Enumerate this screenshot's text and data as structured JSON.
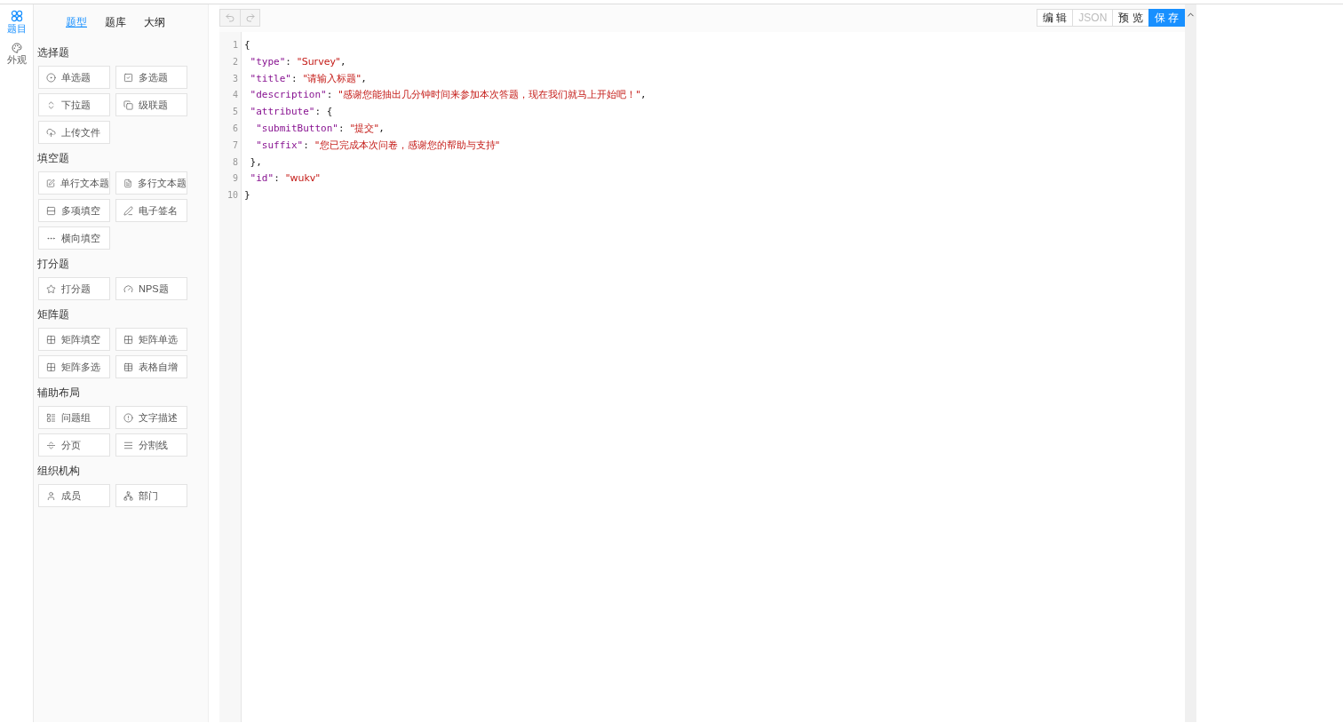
{
  "rail": [
    {
      "label": "题目",
      "selected": true
    },
    {
      "label": "外观",
      "selected": false
    }
  ],
  "tabs": [
    {
      "label": "题型",
      "selected": true
    },
    {
      "label": "题库",
      "selected": false
    },
    {
      "label": "大纲",
      "selected": false
    }
  ],
  "groups": [
    {
      "title": "选择题",
      "items": [
        "单选题",
        "多选题",
        "下拉题",
        "级联题",
        "上传文件"
      ]
    },
    {
      "title": "填空题",
      "items": [
        "单行文本题",
        "多行文本题",
        "多项填空",
        "电子签名",
        "横向填空"
      ]
    },
    {
      "title": "打分题",
      "items": [
        "打分题",
        "NPS题"
      ]
    },
    {
      "title": "矩阵题",
      "items": [
        "矩阵填空",
        "矩阵单选",
        "矩阵多选",
        "表格自增"
      ]
    },
    {
      "title": "辅助布局",
      "items": [
        "问题组",
        "文字描述",
        "分页",
        "分割线"
      ]
    },
    {
      "title": "组织机构",
      "items": [
        "成员",
        "部门"
      ]
    }
  ],
  "actions": [
    {
      "label": "编 辑",
      "kind": "default"
    },
    {
      "label": "JSON",
      "kind": "disabled"
    },
    {
      "label": "预 览",
      "kind": "default"
    },
    {
      "label": "保 存",
      "kind": "primary"
    }
  ],
  "code": [
    {
      "number": "1",
      "tokens": [
        {
          "kind": "plain",
          "text": "{"
        }
      ]
    },
    {
      "number": "2",
      "tokens": [
        {
          "kind": "key",
          "text": " \"type\""
        },
        {
          "kind": "plain",
          "text": ": "
        },
        {
          "kind": "string",
          "text": "\"Survey\""
        },
        {
          "kind": "plain",
          "text": ","
        }
      ]
    },
    {
      "number": "3",
      "tokens": [
        {
          "kind": "key",
          "text": " \"title\""
        },
        {
          "kind": "plain",
          "text": ": "
        },
        {
          "kind": "string",
          "text": "\"请输入标题\""
        },
        {
          "kind": "plain",
          "text": ","
        }
      ]
    },
    {
      "number": "4",
      "tokens": [
        {
          "kind": "key",
          "text": " \"description\""
        },
        {
          "kind": "plain",
          "text": ": "
        },
        {
          "kind": "string",
          "text": "\"感谢您能抽出几分钟时间来参加本次答题，现在我们就马上开始吧！\""
        },
        {
          "kind": "plain",
          "text": ","
        }
      ]
    },
    {
      "number": "5",
      "tokens": [
        {
          "kind": "key",
          "text": " \"attribute\""
        },
        {
          "kind": "plain",
          "text": ": {"
        }
      ]
    },
    {
      "number": "6",
      "tokens": [
        {
          "kind": "key",
          "text": "  \"submitButton\""
        },
        {
          "kind": "plain",
          "text": ": "
        },
        {
          "kind": "string",
          "text": "\"提交\""
        },
        {
          "kind": "plain",
          "text": ","
        }
      ]
    },
    {
      "number": "7",
      "tokens": [
        {
          "kind": "key",
          "text": "  \"suffix\""
        },
        {
          "kind": "plain",
          "text": ": "
        },
        {
          "kind": "string",
          "text": "\"您已完成本次问卷，感谢您的帮助与支持\""
        }
      ]
    },
    {
      "number": "8",
      "tokens": [
        {
          "kind": "plain",
          "text": " },"
        }
      ]
    },
    {
      "number": "9",
      "tokens": [
        {
          "kind": "key",
          "text": " \"id\""
        },
        {
          "kind": "plain",
          "text": ": "
        },
        {
          "kind": "string",
          "text": "\"wukv\""
        }
      ]
    },
    {
      "number": "10",
      "tokens": [
        {
          "kind": "plain",
          "text": "}"
        }
      ]
    }
  ]
}
